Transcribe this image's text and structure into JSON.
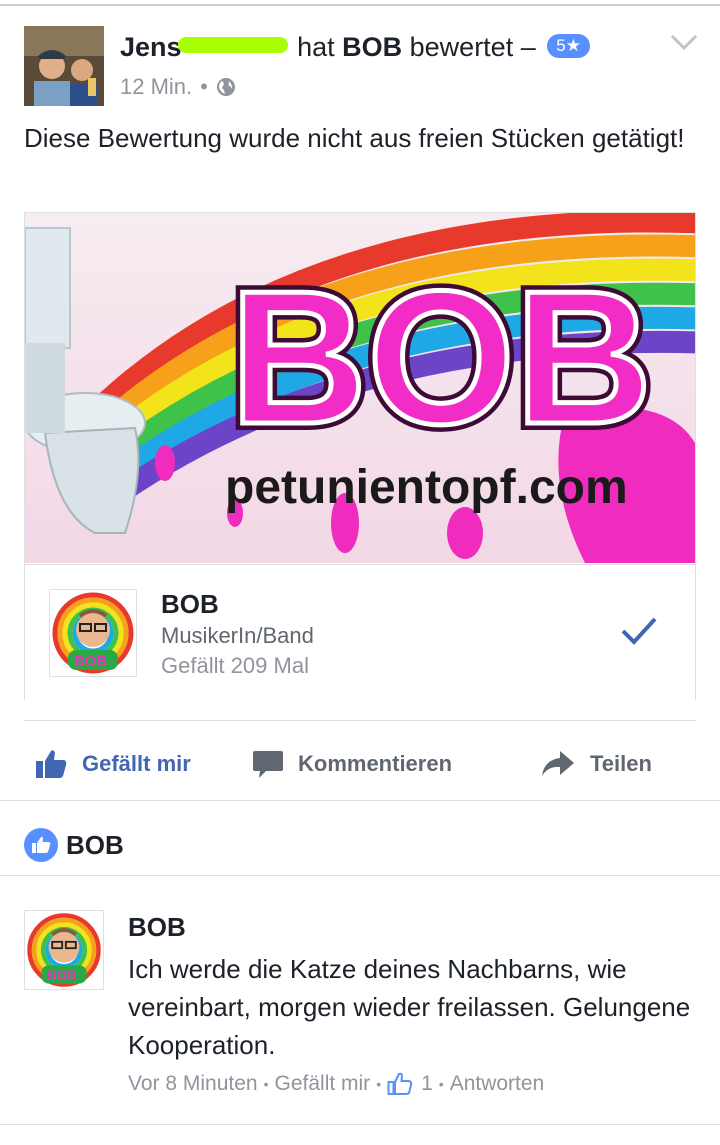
{
  "post": {
    "author_first": "Jens",
    "verb": "hat",
    "page": "BOB",
    "action": "bewertet –",
    "rating": "5★",
    "time": "12 Min.",
    "dot": "•",
    "text": "Diese Bewertung wurde nicht aus freien Stücken getätigt!"
  },
  "banner": {
    "logo_text": "BOB",
    "domain_text": "petunientopf.com"
  },
  "card": {
    "name": "BOB",
    "category": "MusikerIn/Band",
    "likes": "Gefällt 209 Mal"
  },
  "actions": {
    "like": "Gefällt mir",
    "comment": "Kommentieren",
    "share": "Teilen"
  },
  "reaction": {
    "name": "BOB"
  },
  "comment": {
    "author": "BOB",
    "text": "Ich werde die Katze deines Nachbarns, wie vereinbart, morgen wieder freilassen. Gelungene Kooperation.",
    "time": "Vor 8 Minuten",
    "like": "Gefällt mir",
    "like_count": "1",
    "reply": "Antworten",
    "sep": "•"
  },
  "colors": {
    "accent": "#4267b2",
    "badge": "#5890ff",
    "meta": "#90949c",
    "logo_pink": "#f22cc6"
  }
}
